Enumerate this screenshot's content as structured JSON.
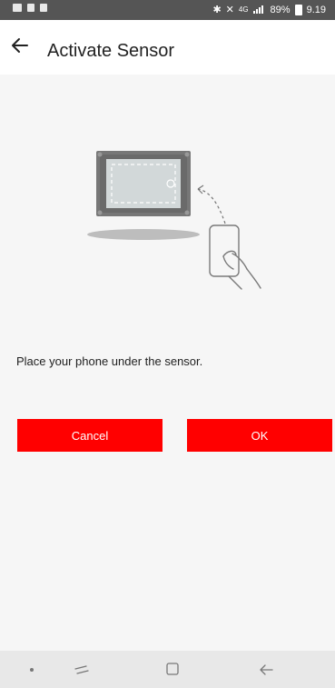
{
  "status_bar": {
    "network": "4G",
    "battery": "89%",
    "time": "9.19"
  },
  "app_bar": {
    "title": "Activate Sensor"
  },
  "main": {
    "instruction": "Place your phone under the sensor."
  },
  "buttons": {
    "cancel_label": "Cancel",
    "ok_label": "OK"
  },
  "colors": {
    "accent": "#ff0000",
    "status_bar": "#555555"
  },
  "icons": {
    "back": "arrow-left-icon",
    "sensor": "sensor-device-illustration",
    "phone": "hand-holding-phone-illustration"
  }
}
